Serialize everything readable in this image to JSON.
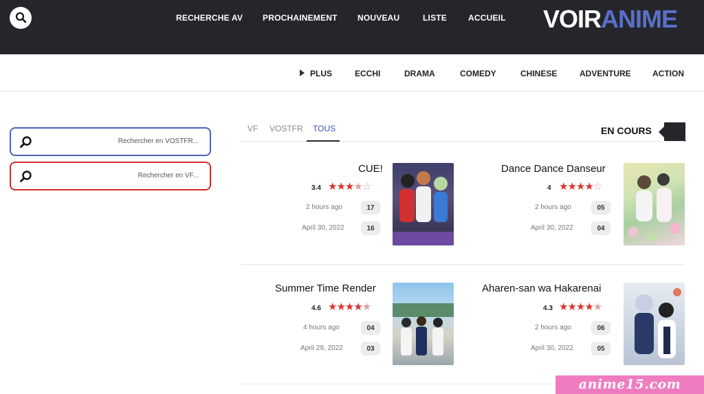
{
  "header": {
    "logo_part1": "VOIR",
    "logo_part2": "ANIME",
    "nav": [
      "ACCUEIL",
      "LISTE",
      "NOUVEAU",
      "PROCHAINEMENT",
      "RECHERCHE AV"
    ]
  },
  "genres": [
    "ACTION",
    "ADVENTURE",
    "CHINESE",
    "COMEDY",
    "DRAMA",
    "ECCHI",
    "PLUS"
  ],
  "sidebar": {
    "vostfr_placeholder": "Rechercher en VOSTFR...",
    "vf_placeholder": "Rechercher en VF..."
  },
  "section": {
    "title": "EN COURS",
    "tabs": [
      "TOUS",
      "VOSTFR",
      "VF"
    ],
    "active_tab": "TOUS"
  },
  "cards": [
    {
      "title": "Dance Dance Danseur",
      "rating": "4",
      "stars_full": 4,
      "stars_empty": 1,
      "episodes": [
        {
          "ep": "05",
          "time": "2 hours ago"
        },
        {
          "ep": "04",
          "time": "April 30, 2022"
        }
      ]
    },
    {
      "title": "CUE!",
      "rating": "3.4",
      "stars_full": 3.5,
      "stars_empty": 1.5,
      "episodes": [
        {
          "ep": "17",
          "time": "2 hours ago"
        },
        {
          "ep": "16",
          "time": "April 30, 2022"
        }
      ]
    },
    {
      "title": "Aharen-san wa Hakarenai",
      "rating": "4.3",
      "stars_full": 4.5,
      "stars_empty": 0.5,
      "episodes": [
        {
          "ep": "06",
          "time": "2 hours ago"
        },
        {
          "ep": "05",
          "time": "April 30, 2022"
        }
      ]
    },
    {
      "title": "Summer Time Render",
      "rating": "4.6",
      "stars_full": 4.5,
      "stars_empty": 0.5,
      "episodes": [
        {
          "ep": "04",
          "time": "4 hours ago"
        },
        {
          "ep": "03",
          "time": "April 29, 2022"
        }
      ]
    }
  ],
  "watermark": "anime15.com",
  "colors": {
    "header_bg": "#24262b",
    "accent": "#5b6fc9",
    "vostfr_border": "#4a63b5",
    "vf_border": "#d02a2a",
    "star": "#e0312f"
  }
}
